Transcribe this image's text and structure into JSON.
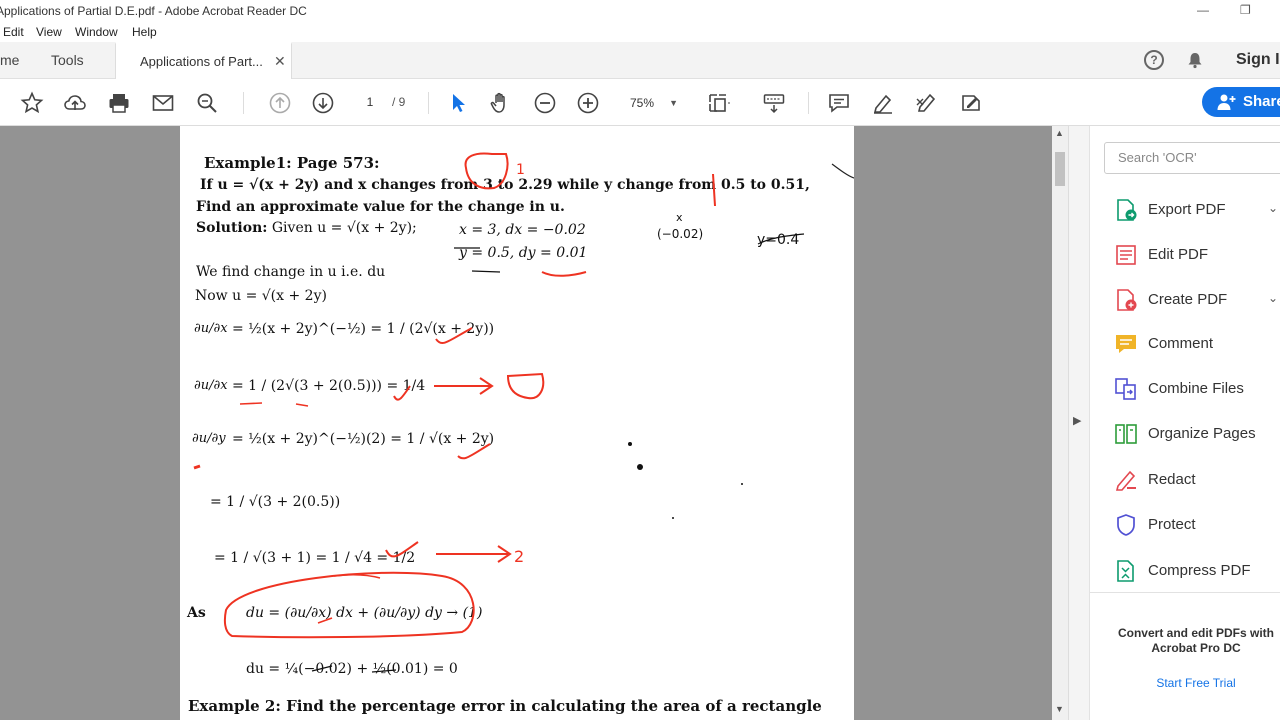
{
  "window": {
    "title": "Applications of Partial D.E.pdf - Adobe Acrobat Reader DC"
  },
  "menu": [
    "Edit",
    "View",
    "Window",
    "Help"
  ],
  "tabs": {
    "home": "me",
    "tools": "Tools",
    "doc_tab": "Applications of Part...",
    "sign_in": "Sign I"
  },
  "toolbar": {
    "page_current": "1",
    "page_total": "/ 9",
    "zoom": "75%",
    "share": "Share"
  },
  "right_pane": {
    "search_placeholder": "Search 'OCR'",
    "tools": [
      {
        "label": "Export PDF",
        "icon": "export-pdf-icon",
        "expandable": true
      },
      {
        "label": "Edit PDF",
        "icon": "edit-pdf-icon",
        "expandable": false
      },
      {
        "label": "Create PDF",
        "icon": "create-pdf-icon",
        "expandable": true
      },
      {
        "label": "Comment",
        "icon": "comment-icon",
        "expandable": false
      },
      {
        "label": "Combine Files",
        "icon": "combine-files-icon",
        "expandable": false
      },
      {
        "label": "Organize Pages",
        "icon": "organize-pages-icon",
        "expandable": false
      },
      {
        "label": "Redact",
        "icon": "redact-icon",
        "expandable": false
      },
      {
        "label": "Protect",
        "icon": "protect-icon",
        "expandable": false
      },
      {
        "label": "Compress PDF",
        "icon": "compress-pdf-icon",
        "expandable": false
      }
    ],
    "promo": "Convert and edit PDFs with Acrobat Pro DC",
    "trial": "Start Free Trial"
  },
  "document": {
    "example1_heading": "Example1: Page 573:",
    "example1_q1_a": "If u = √(x + 2y) and x changes from ",
    "example1_q1_b": "3 to 2.29",
    "example1_q1_c": " while y change from ",
    "example1_q1_d": "0.5 to 0.51",
    "example1_q1_e": ",",
    "example1_q2": "Find an approximate value for the change in u.",
    "solution_label": "Solution:",
    "solution_text": "Given u = √(x + 2y);",
    "given_x": "x = 3, dx = −0.02",
    "given_y": "y = 0.5, dy = 0.01",
    "note_dx": "(−0.02)",
    "note_x": "x",
    "note_y": "y=0.4",
    "l_change": "We find change in u i.e. du",
    "l_now": "Now u = √(x + 2y)",
    "eq1_lhs": "∂u/∂x",
    "eq1": "= ½(x + 2y)^(−½) = 1 / (2√(x + 2y))",
    "eq2_lhs": "∂u/∂x",
    "eq2": "= 1 / (2√(3 + 2(0.5))) = 1/4",
    "eq3_lhs": "∂u/∂y",
    "eq3": "= ½(x + 2y)^(−½)(2) = 1 / √(x + 2y)",
    "eq4": "= 1 / √(3 + 2(0.5))",
    "eq5": "= 1 / √(3 + 1) = 1 / √4 = 1/2",
    "as_label": "As",
    "eq6": "du = (∂u/∂x) dx + (∂u/∂y) dy → (1)",
    "eq7": "du = ¼(−0.02) + ½(0.01) = 0",
    "example2": "Example 2: Find the percentage error in calculating the area of a rectangle",
    "ink_a1": "1",
    "ink_a2": "2"
  }
}
